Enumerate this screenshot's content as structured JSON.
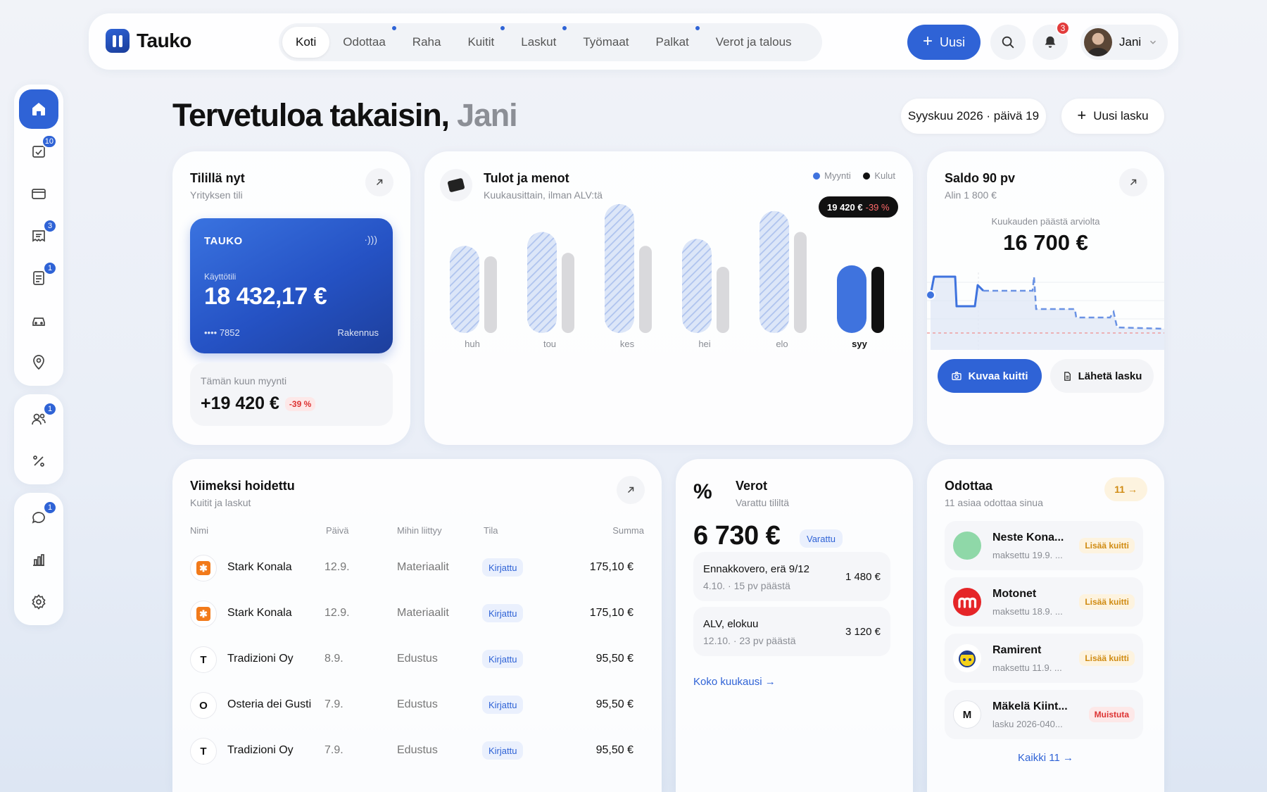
{
  "app": {
    "name": "Tauko",
    "new_label": "Uusi",
    "notif_count": "3",
    "user_name": "Jani"
  },
  "nav": [
    {
      "label": "Koti",
      "active": true,
      "dot": false
    },
    {
      "label": "Odottaa",
      "active": false,
      "dot": true
    },
    {
      "label": "Raha",
      "active": false,
      "dot": false
    },
    {
      "label": "Kuitit",
      "active": false,
      "dot": true
    },
    {
      "label": "Laskut",
      "active": false,
      "dot": true
    },
    {
      "label": "Työmaat",
      "active": false,
      "dot": false
    },
    {
      "label": "Palkat",
      "active": false,
      "dot": true
    },
    {
      "label": "Verot ja talous",
      "active": false,
      "dot": false
    }
  ],
  "sidebar": {
    "home_badge": "",
    "tasks_badge": "10",
    "invoices_badge": "3",
    "docs_badge": "1",
    "people_badge": "1",
    "chat_badge": "1"
  },
  "header": {
    "greeting": "Tervetuloa takaisin,",
    "greeting_name": "Jani",
    "date_label": "Syyskuu 2026 · päivä 19",
    "new_invoice_label": "Uusi lasku"
  },
  "account": {
    "title": "Tilillä nyt",
    "subtitle": "Yrityksen tili",
    "card_brand": "TAUKO",
    "card_account": "Käyttötili",
    "card_balance": "18 432,17 €",
    "card_number": "•••• 7852",
    "card_tag": "Rakennus",
    "sales_label": "Tämän kuun myynti",
    "sales_value": "+19 420 €",
    "sales_change": "-39 %"
  },
  "income": {
    "title": "Tulot ja menot",
    "subtitle": "Kuukausittain, ilman ALV:tä",
    "legend_sales": "Myynti",
    "legend_costs": "Kulut",
    "tooltip_value": "19 420 €",
    "tooltip_change": "-39 %"
  },
  "chart_data": {
    "type": "bar",
    "categories": [
      "huh",
      "tou",
      "kes",
      "hei",
      "elo",
      "syy"
    ],
    "series": [
      {
        "name": "Myynti",
        "values": [
          25000,
          29000,
          37000,
          27000,
          35000,
          19420
        ]
      },
      {
        "name": "Kulut",
        "values": [
          22000,
          23000,
          25000,
          19000,
          29000,
          19000
        ]
      }
    ],
    "ylim": [
      0,
      40000
    ],
    "colors": {
      "sales_past": "#bfd0f2",
      "sales_current": "#3f73de",
      "costs_past": "#d9d9dc",
      "costs_current": "#111111"
    }
  },
  "balance": {
    "title": "Saldo 90 pv",
    "subtitle": "Alin 1 800 €",
    "forecast_label": "Kuukauden päästä arviolta",
    "forecast_value": "16 700 €",
    "btn_receipt": "Kuvaa kuitti",
    "btn_send": "Lähetä lasku"
  },
  "recent": {
    "title": "Viimeksi hoidettu",
    "subtitle": "Kuitit ja laskut",
    "headers": {
      "name": "Nimi",
      "date": "Päivä",
      "category": "Mihin liittyy",
      "status": "Tila",
      "sum": "Summa"
    },
    "rows": [
      {
        "initial": "",
        "logo": "stark",
        "name": "Stark Konala",
        "date": "12.9.",
        "category": "Materiaalit",
        "status": "Kirjattu",
        "sum": "175,10 €"
      },
      {
        "initial": "",
        "logo": "stark",
        "name": "Stark Konala",
        "date": "12.9.",
        "category": "Materiaalit",
        "status": "Kirjattu",
        "sum": "175,10 €"
      },
      {
        "initial": "T",
        "logo": "",
        "name": "Tradizioni Oy",
        "date": "8.9.",
        "category": "Edustus",
        "status": "Kirjattu",
        "sum": "95,50 €"
      },
      {
        "initial": "O",
        "logo": "",
        "name": "Osteria dei Gusti",
        "date": "7.9.",
        "category": "Edustus",
        "status": "Kirjattu",
        "sum": "95,50 €"
      },
      {
        "initial": "T",
        "logo": "",
        "name": "Tradizioni Oy",
        "date": "7.9.",
        "category": "Edustus",
        "status": "Kirjattu",
        "sum": "95,50 €"
      }
    ]
  },
  "taxes": {
    "icon": "%",
    "title": "Verot",
    "subtitle": "Varattu tililtä",
    "amount": "6 730 €",
    "badge": "Varattu",
    "items": [
      {
        "name": "Ennakkovero, erä 9/12",
        "due": "4.10. · 15 pv päästä",
        "amount": "1 480 €"
      },
      {
        "name": "ALV, elokuu",
        "due": "12.10. · 23 pv päästä",
        "amount": "3 120 €"
      }
    ],
    "link": "Koko kuukausi →"
  },
  "pending": {
    "title": "Odottaa",
    "subtitle": "11 asiaa odottaa sinua",
    "count_label": "11 →",
    "items": [
      {
        "name": "Neste Kona...",
        "sub": "maksettu 19.9. ...",
        "badge": "Lisää kuitti",
        "kind": "warn",
        "avatar": "neste",
        "initial": ""
      },
      {
        "name": "Motonet",
        "sub": "maksettu 18.9. ...",
        "badge": "Lisää kuitti",
        "kind": "warn",
        "avatar": "motonet",
        "initial": ""
      },
      {
        "name": "Ramirent",
        "sub": "maksettu 11.9. ...",
        "badge": "Lisää kuitti",
        "kind": "warn",
        "avatar": "ramirent",
        "initial": ""
      },
      {
        "name": "Mäkelä Kiint...",
        "sub": "lasku 2026-040...",
        "badge": "Muistuta",
        "kind": "red",
        "avatar": "",
        "initial": "M"
      }
    ],
    "link": "Kaikki 11 →"
  }
}
